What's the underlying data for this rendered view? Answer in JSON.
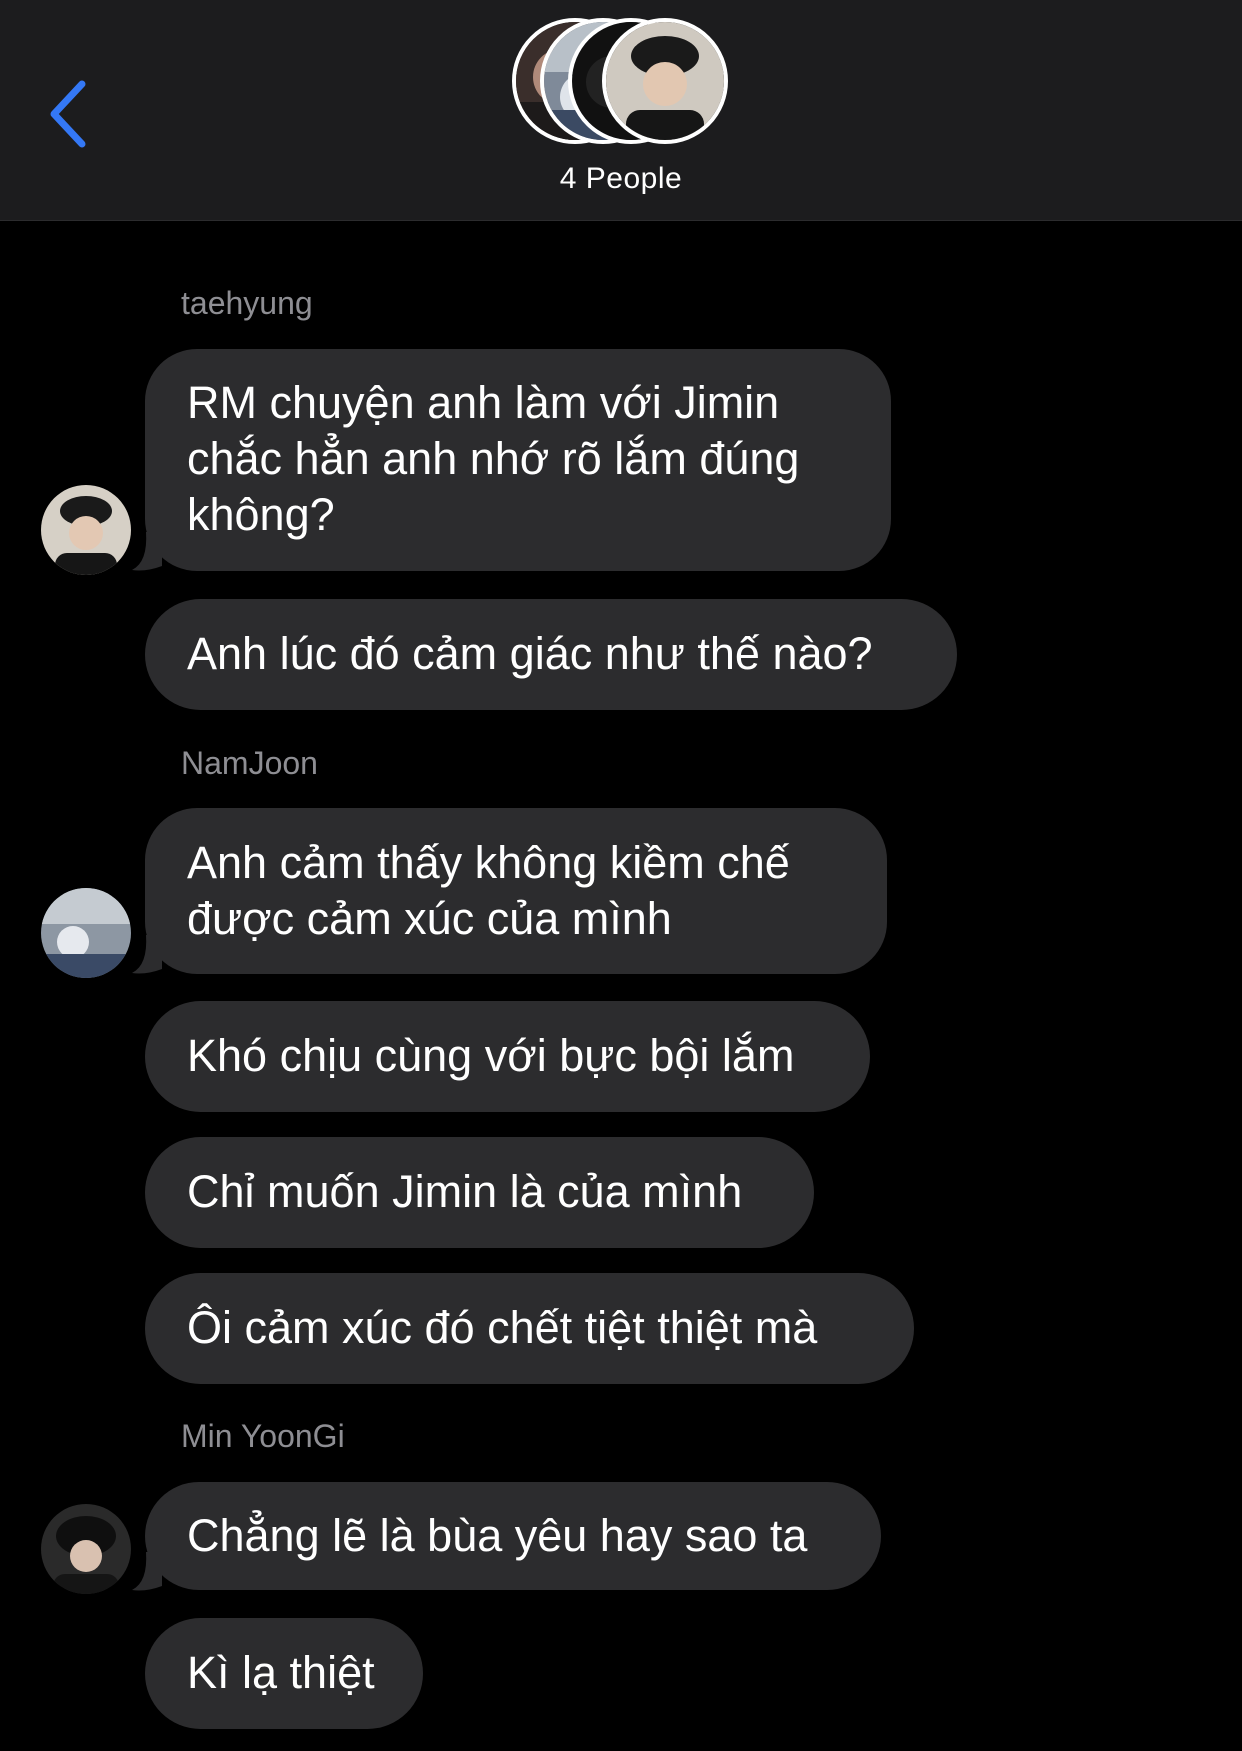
{
  "header": {
    "people_count": "4 People",
    "accent_color": "#3478f6",
    "back_icon": "chevron-left-icon"
  },
  "messages": [
    {
      "sender": "taehyung",
      "bubbles": [
        "RM chuyện anh làm với Jimin chắc hẳn anh nhớ rõ lắm đúng không?",
        "Anh lúc đó cảm giác như thế nào?"
      ]
    },
    {
      "sender": "NamJoon",
      "bubbles": [
        "Anh cảm thấy không kiềm chế được cảm xúc của mình",
        "Khó chịu cùng với bực bội lắm",
        "Chỉ muốn Jimin là của mình",
        "Ôi cảm xúc đó chết tiệt thiệt mà"
      ]
    },
    {
      "sender": "Min YoonGi",
      "bubbles": [
        "Chẳng lẽ là bùa yêu hay sao ta",
        "Kì lạ thiệt"
      ]
    }
  ],
  "colors": {
    "background": "#000000",
    "header": "#1c1c1e",
    "bubble": "#2c2c2e",
    "sender_name": "#8e8e93"
  }
}
